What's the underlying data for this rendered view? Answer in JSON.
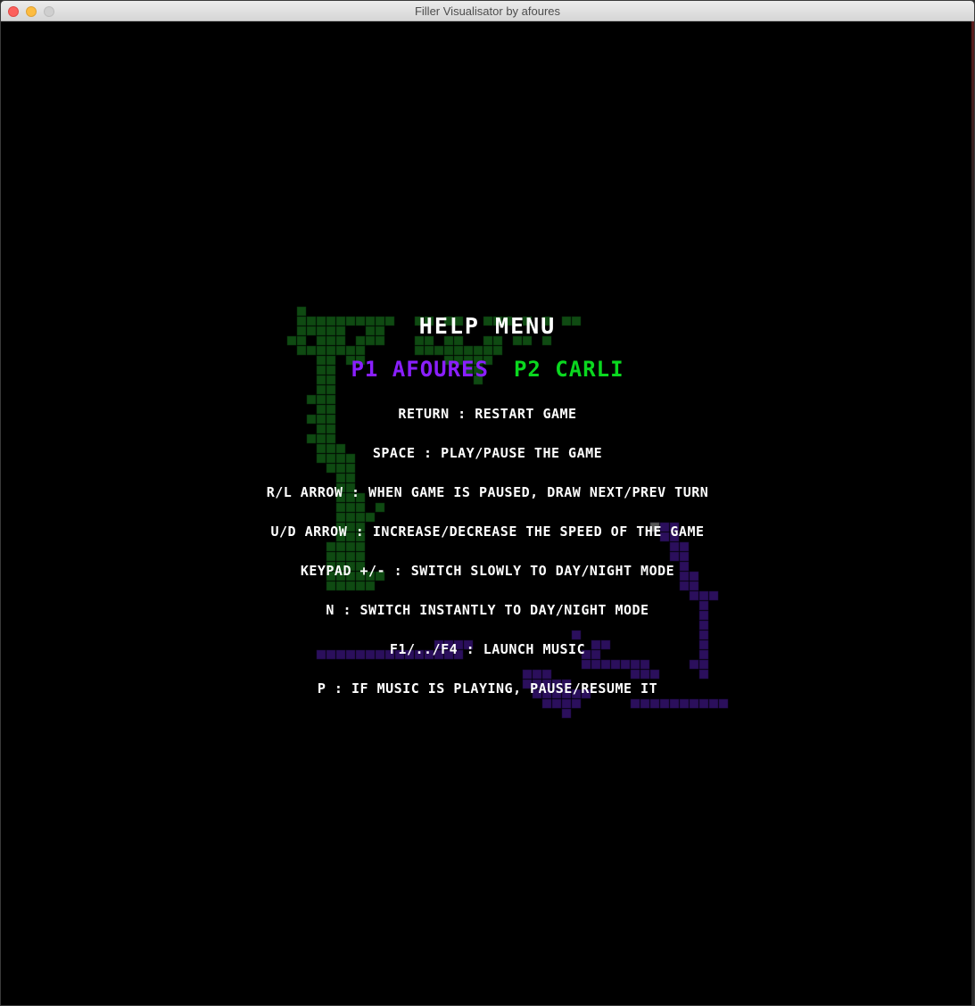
{
  "window": {
    "title": "Filler Visualisator by afoures"
  },
  "help": {
    "title": "HELP MENU",
    "player1": "P1 AFOURES",
    "player2": "P2 CARLI",
    "lines": [
      "RETURN : RESTART GAME",
      "SPACE : PLAY/PAUSE THE GAME",
      "R/L ARROW : WHEN GAME IS PAUSED, DRAW NEXT/PREV TURN",
      "U/D ARROW : INCREASE/DECREASE THE SPEED OF THE GAME",
      "KEYPAD +/- : SWITCH SLOWLY TO DAY/NIGHT MODE",
      "N : SWITCH INSTANTLY TO DAY/NIGHT MODE",
      "F1/../F4 : LAUNCH MUSIC",
      "P : IF MUSIC IS PLAYING, PAUSE/RESUME IT"
    ]
  },
  "colors": {
    "background": "#000000",
    "player1": "#8a1fff",
    "player2": "#0ad81f",
    "player1_board_dim": "#2b0f5c",
    "player2_board_dim": "#0f4a12",
    "last_piece": "#555555"
  }
}
